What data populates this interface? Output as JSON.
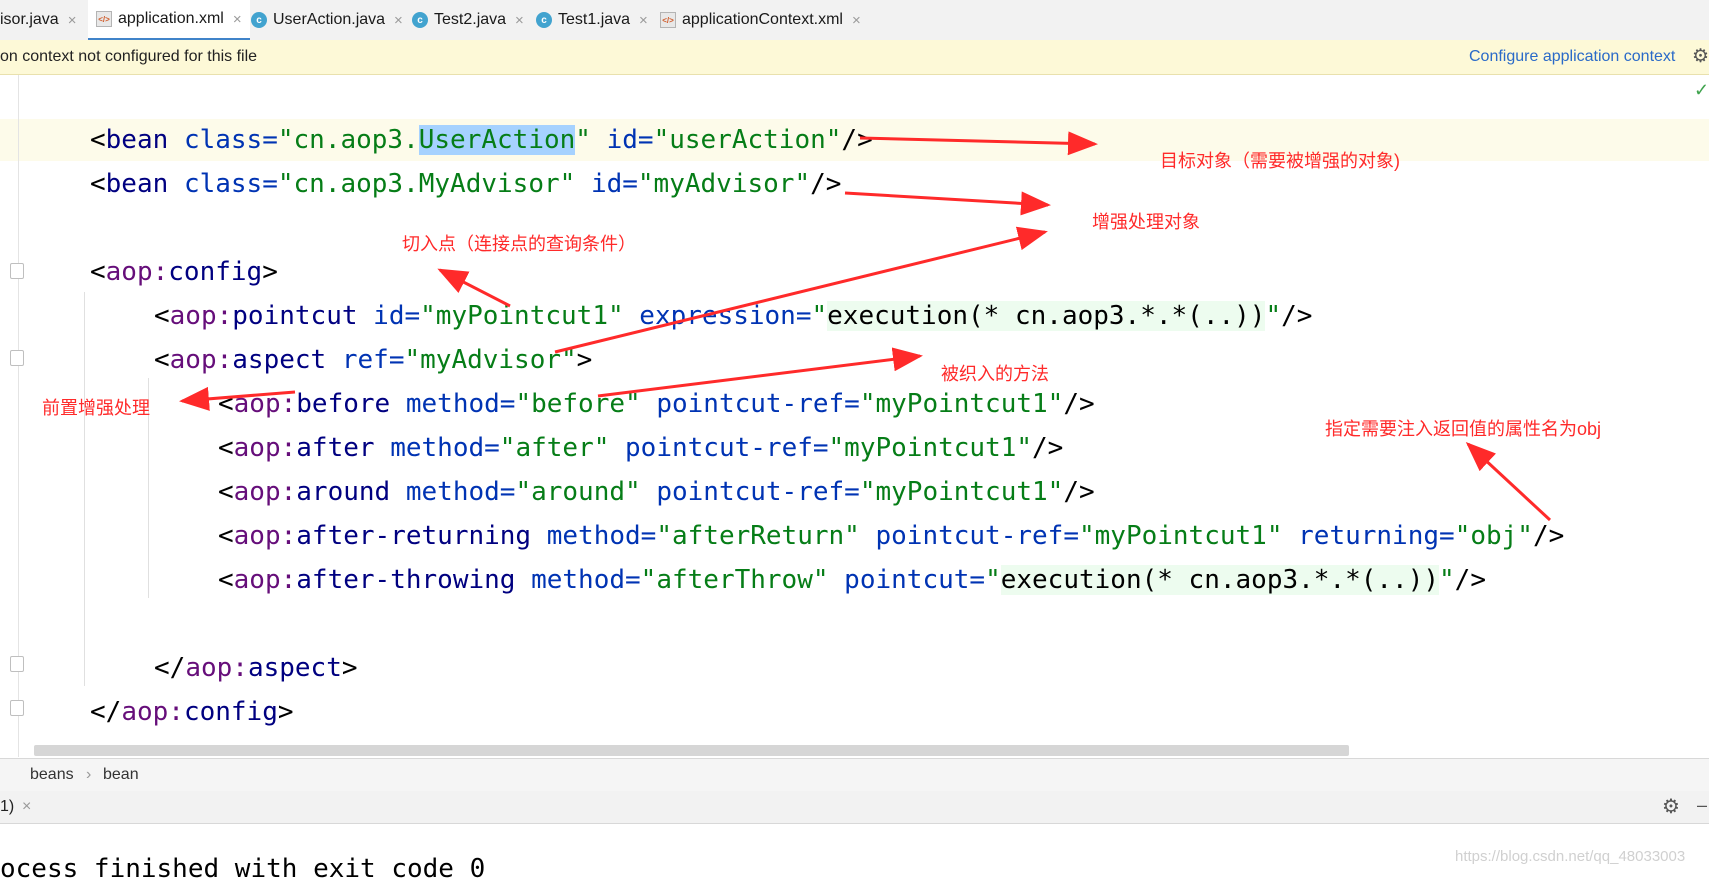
{
  "tabs": [
    {
      "label": "isor.java",
      "icon": "class-icon"
    },
    {
      "label": "application.xml",
      "icon": "xml-icon",
      "active": true
    },
    {
      "label": "UserAction.java",
      "icon": "class-icon"
    },
    {
      "label": "Test2.java",
      "icon": "test-class-icon"
    },
    {
      "label": "Test1.java",
      "icon": "test-class-icon"
    },
    {
      "label": "applicationContext.xml",
      "icon": "xml-icon"
    }
  ],
  "tab_close": "×",
  "notification": {
    "message": "on context not configured for this file",
    "action": "Configure application context"
  },
  "code": {
    "line1": {
      "p1": "<",
      "tag": "bean",
      "sp1": " ",
      "a1": "class=",
      "v1a": "\"cn.aop3.",
      "v1sel": "UserAction",
      "v1b": "\"",
      "sp2": " ",
      "a2": "id=",
      "v2": "\"userAction\"",
      "end": "/>"
    },
    "line2": {
      "p1": "<",
      "tag": "bean",
      "sp1": " ",
      "a1": "class=",
      "v1": "\"cn.aop3.MyAdvisor\"",
      "sp2": " ",
      "a2": "id=",
      "v2": "\"myAdvisor\"",
      "end": "/>"
    },
    "line3": {
      "p1": "<",
      "ns": "aop:",
      "tag": "config",
      "end": ">"
    },
    "line4": {
      "p1": "<",
      "ns": "aop:",
      "tag": "pointcut",
      "sp1": " ",
      "a1": "id=",
      "v1": "\"myPointcut1\"",
      "sp2": " ",
      "a2": "expression=",
      "q1": "\"",
      "inj": "execution(* cn.aop3.*.*(..))",
      "q2": "\"",
      "end": "/>"
    },
    "line5": {
      "p1": "<",
      "ns": "aop:",
      "tag": "aspect",
      "sp1": " ",
      "a1": "ref=",
      "v1": "\"myAdvisor\"",
      "end": ">"
    },
    "line6": {
      "p1": "<",
      "ns": "aop:",
      "tag": "before",
      "sp1": " ",
      "a1": "method=",
      "v1": "\"before\"",
      "sp2": " ",
      "a2": "pointcut-ref=",
      "v2": "\"myPointcut1\"",
      "end": "/>"
    },
    "line7": {
      "p1": "<",
      "ns": "aop:",
      "tag": "after",
      "sp1": " ",
      "a1": "method=",
      "v1": "\"after\"",
      "sp2": " ",
      "a2": "pointcut-ref=",
      "v2": "\"myPointcut1\"",
      "end": "/>"
    },
    "line8": {
      "p1": "<",
      "ns": "aop:",
      "tag": "around",
      "sp1": " ",
      "a1": "method=",
      "v1": "\"around\"",
      "sp2": " ",
      "a2": "pointcut-ref=",
      "v2": "\"myPointcut1\"",
      "end": "/>"
    },
    "line9": {
      "p1": "<",
      "ns": "aop:",
      "tag": "after-returning",
      "sp1": " ",
      "a1": "method=",
      "v1": "\"afterReturn\"",
      "sp2": " ",
      "a2": "pointcut-ref=",
      "v2": "\"myPointcut1\"",
      "sp3": " ",
      "a3": "returning=",
      "v3": "\"obj\"",
      "end": "/>"
    },
    "line10": {
      "p1": "<",
      "ns": "aop:",
      "tag": "after-throwing",
      "sp1": " ",
      "a1": "method=",
      "v1": "\"afterThrow\"",
      "sp2": " ",
      "a2": "pointcut=",
      "q1": "\"",
      "inj": "execution(* cn.aop3.*.*(..))",
      "q2": "\"",
      "end": "/>"
    },
    "line11": {
      "p1": "</",
      "ns": "aop:",
      "tag": "aspect",
      "end": ">"
    },
    "line12": {
      "p1": "</",
      "ns": "aop:",
      "tag": "config",
      "end": ">"
    }
  },
  "annotations": {
    "target": "目标对象（需要被增强的对象)",
    "advice": "增强处理对象",
    "pointcut": "切入点（连接点的查询条件）",
    "woven": "被织入的方法",
    "before": "前置增强处理",
    "returning": "指定需要注入返回值的属性名为obj"
  },
  "breadcrumb": [
    "beans",
    "bean"
  ],
  "breadcrumb_sep": "›",
  "run": {
    "tab": "1)",
    "close": "×"
  },
  "console": {
    "output": "ocess finished with exit code 0"
  },
  "watermark": "https://blog.csdn.net/qq_48033003",
  "colors": {
    "tag": "#000080",
    "namespace": "#660e7a",
    "attribute": "#0033b3",
    "string": "#067d17",
    "annotation": "#ff2a2a",
    "link": "#2a6ac8"
  }
}
